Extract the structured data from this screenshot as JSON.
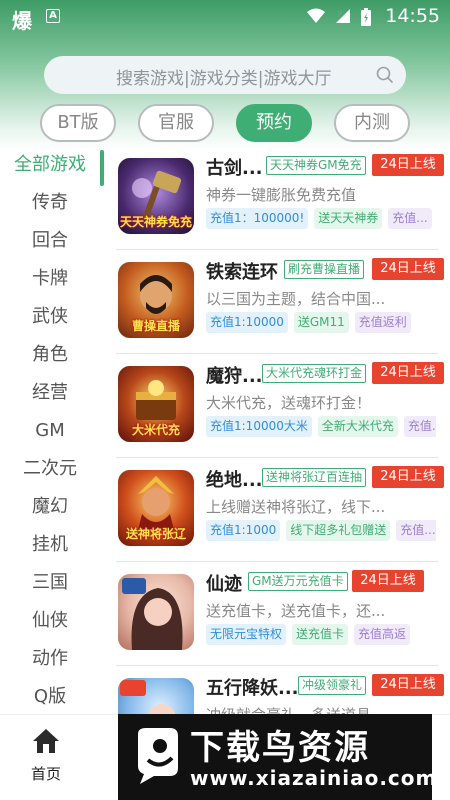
{
  "status_bar": {
    "app_glyph": "爆",
    "badge": "A",
    "time": "14:55"
  },
  "search": {
    "placeholder": "搜索游戏|游戏分类|游戏大厅"
  },
  "tabs": [
    {
      "label": "BT版",
      "active": false
    },
    {
      "label": "官服",
      "active": false
    },
    {
      "label": "预约",
      "active": true
    },
    {
      "label": "内测",
      "active": false
    }
  ],
  "sidebar": [
    "全部游戏",
    "传奇",
    "回合",
    "卡牌",
    "武侠",
    "角色",
    "经营",
    "GM",
    "二次元",
    "魔幻",
    "挂机",
    "三国",
    "仙侠",
    "动作",
    "Q版"
  ],
  "games": [
    {
      "name": "古剑...",
      "tag": "天天神券GM免充",
      "date": "24日上线",
      "desc": "神券一键膨胀免费充值",
      "pills": [
        {
          "text": "充值1：100000!",
          "c": "blue"
        },
        {
          "text": "送天天神券",
          "c": "green"
        },
        {
          "text": "充值...",
          "c": "purple"
        }
      ],
      "thumb_caption": "天天神券免充",
      "color": "#4a2a6e"
    },
    {
      "name": "铁索连环",
      "tag": "刷充曹操直播",
      "date": "24日上线",
      "desc": "以三国为主题，结合中国...",
      "pills": [
        {
          "text": "充值1:10000",
          "c": "blue"
        },
        {
          "text": "送GM11",
          "c": "green"
        },
        {
          "text": "充值返利",
          "c": "purple"
        }
      ],
      "thumb_caption": "曹操直播",
      "color": "#c25a1e"
    },
    {
      "name": "魔狩...",
      "tag": "大米代充魂环打金",
      "date": "24日上线",
      "desc": "大米代充，送魂环打金！",
      "pills": [
        {
          "text": "充值1:10000大米",
          "c": "blue"
        },
        {
          "text": "全新大米代充",
          "c": "green"
        },
        {
          "text": "充值...",
          "c": "purple"
        }
      ],
      "thumb_caption": "大米代充",
      "color": "#8a1e12"
    },
    {
      "name": "绝地...",
      "tag": "送神将张辽百连抽",
      "date": "24日上线",
      "desc": "上线赠送神将张辽，线下...",
      "pills": [
        {
          "text": "充值1:1000",
          "c": "blue"
        },
        {
          "text": "线下超多礼包赠送",
          "c": "green"
        },
        {
          "text": "充值...",
          "c": "purple"
        }
      ],
      "thumb_caption": "送神将张辽",
      "color": "#b0341a"
    },
    {
      "name": "仙迹",
      "tag": "GM送万元充值卡",
      "date": "24日上线",
      "desc": "送充值卡，送充值卡，还...",
      "pills": [
        {
          "text": "无限元宝特权",
          "c": "blue"
        },
        {
          "text": "送充值卡",
          "c": "green"
        },
        {
          "text": "充值高返",
          "c": "purple"
        }
      ],
      "thumb_caption": "",
      "color": "#e7b9a8"
    },
    {
      "name": "五行降妖...",
      "tag": "冲级领豪礼",
      "date": "24日上线",
      "desc": "冲级就会豪礼，多送道具",
      "pills": [],
      "thumb_caption": "",
      "color": "#7fb6e8"
    }
  ],
  "bottom_nav": {
    "home_label": "首页"
  },
  "watermark": {
    "title": "下载鸟资源",
    "url": "www.xiazainiao.com"
  }
}
